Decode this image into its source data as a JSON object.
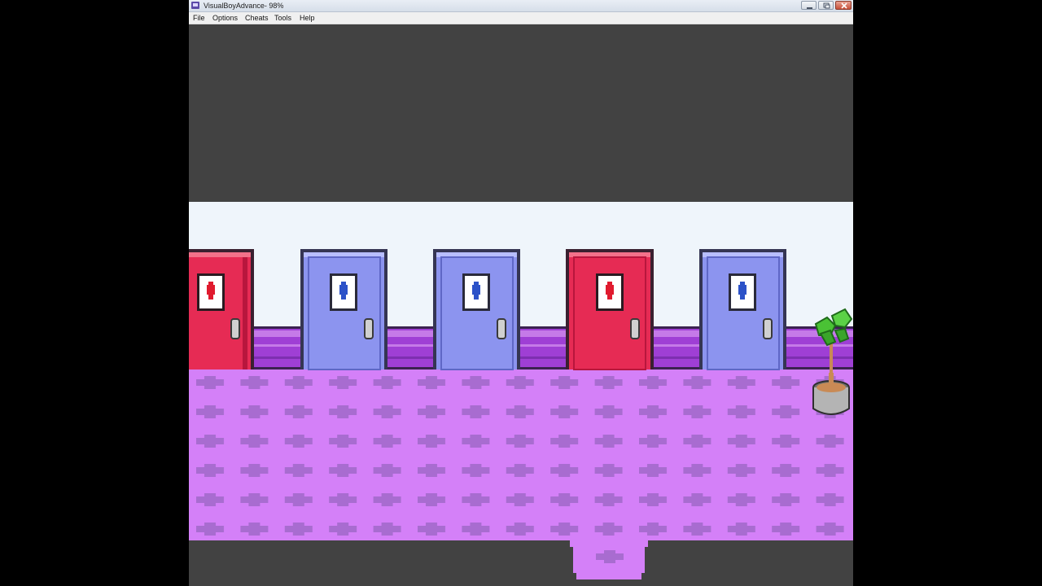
{
  "window": {
    "title": "VisualBoyAdvance- 98%",
    "controls": [
      "minimize",
      "maximize",
      "close"
    ]
  },
  "menu": [
    {
      "label": "File"
    },
    {
      "label": "Options"
    },
    {
      "label": "Cheats"
    },
    {
      "label": "Tools"
    },
    {
      "label": "Help"
    }
  ],
  "game_scene": {
    "description_icons": [
      "red-door-icon",
      "blue-door-icon",
      "blue-door-icon",
      "red-door-icon",
      "blue-door-icon",
      "potted-plant-icon"
    ],
    "colors": {
      "wall": "#eff5fb",
      "wainscot": "#9f3fd5",
      "floor": "#d480f8",
      "floor_pattern": "#a86cd0",
      "door_red": "#e62b54",
      "door_blue": "#8c94ef",
      "background": "#424242"
    }
  }
}
